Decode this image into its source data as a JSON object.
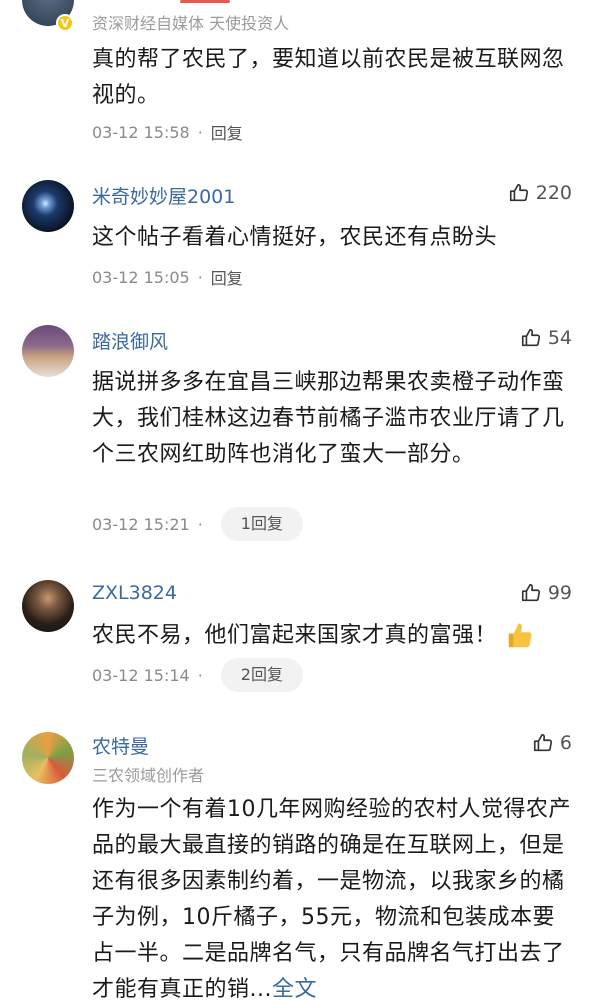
{
  "comments": [
    {
      "subtitle": "资深财经自媒体 天使投资人",
      "text": "真的帮了农民了，要知道以前农民是被互联网忽视的。",
      "time": "03-12 15:58",
      "reply": "回复"
    },
    {
      "username": "米奇妙妙屋2001",
      "likes": "220",
      "text": "这个帖子看着心情挺好，农民还有点盼头",
      "time": "03-12 15:05",
      "reply": "回复"
    },
    {
      "username": "踏浪御风",
      "likes": "54",
      "text": "据说拼多多在宜昌三峡那边帮果农卖橙子动作蛮大，我们桂林这边春节前橘子滥市农业厅请了几个三农网红助阵也消化了蛮大一部分。",
      "time": "03-12 15:21",
      "reply": "1回复"
    },
    {
      "username": "ZXL3824",
      "likes": "99",
      "text": "农民不易，他们富起来国家才真的富强！",
      "time": "03-12 15:14",
      "reply": "2回复"
    },
    {
      "username": "农特曼",
      "subtitle": "三农领域创作者",
      "likes": "6",
      "text": "作为一个有着10几年网购经验的农村人觉得农产品的最大最直接的销路的确是在互联网上，但是还有很多因素制约着，一是物流，以我家乡的橘子为例，10斤橘子，55元，物流和包装成本要占一半。二是品牌名气，只有品牌名气打出去了才能有真正的销...",
      "full_text_link": "全文"
    }
  ],
  "colors": {
    "username": "#3a6aa0",
    "verified_badge": "#f5c518",
    "accent": "#e85a4f"
  }
}
